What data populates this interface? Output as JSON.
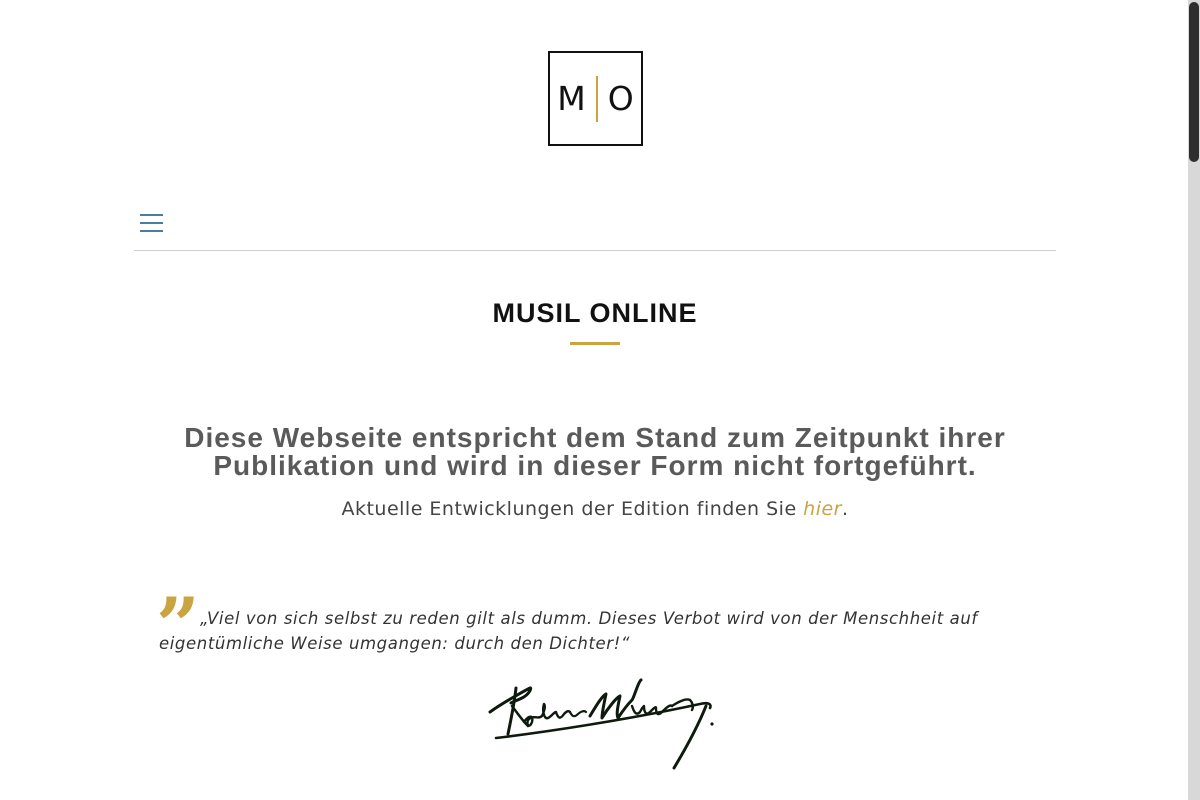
{
  "logo": {
    "left_letter": "M",
    "right_letter": "O",
    "accent_color": "#c9a441"
  },
  "nav": {
    "menu_icon": "hamburger-menu-icon"
  },
  "main": {
    "title": "MUSIL ONLINE",
    "notice": "Diese Webseite entspricht dem Stand zum Zeitpunkt ihrer Publikation und wird in dieser Form nicht fortgeführt.",
    "subnotice_prefix": "Aktuelle Entwicklungen der Edition finden Sie ",
    "subnotice_link": "hier",
    "subnotice_suffix": "."
  },
  "quote": {
    "mark": "”",
    "text": "„Viel von sich selbst zu reden gilt als dumm. Dieses Verbot wird von der Menschheit auf eigentümliche Weise umgangen: durch den Dichter!“",
    "signature_icon": "robert-musil-signature"
  },
  "colors": {
    "accent": "#c9a441",
    "heading": "#111111",
    "notice": "#5a5a5a",
    "menu": "#4a7ea0"
  }
}
